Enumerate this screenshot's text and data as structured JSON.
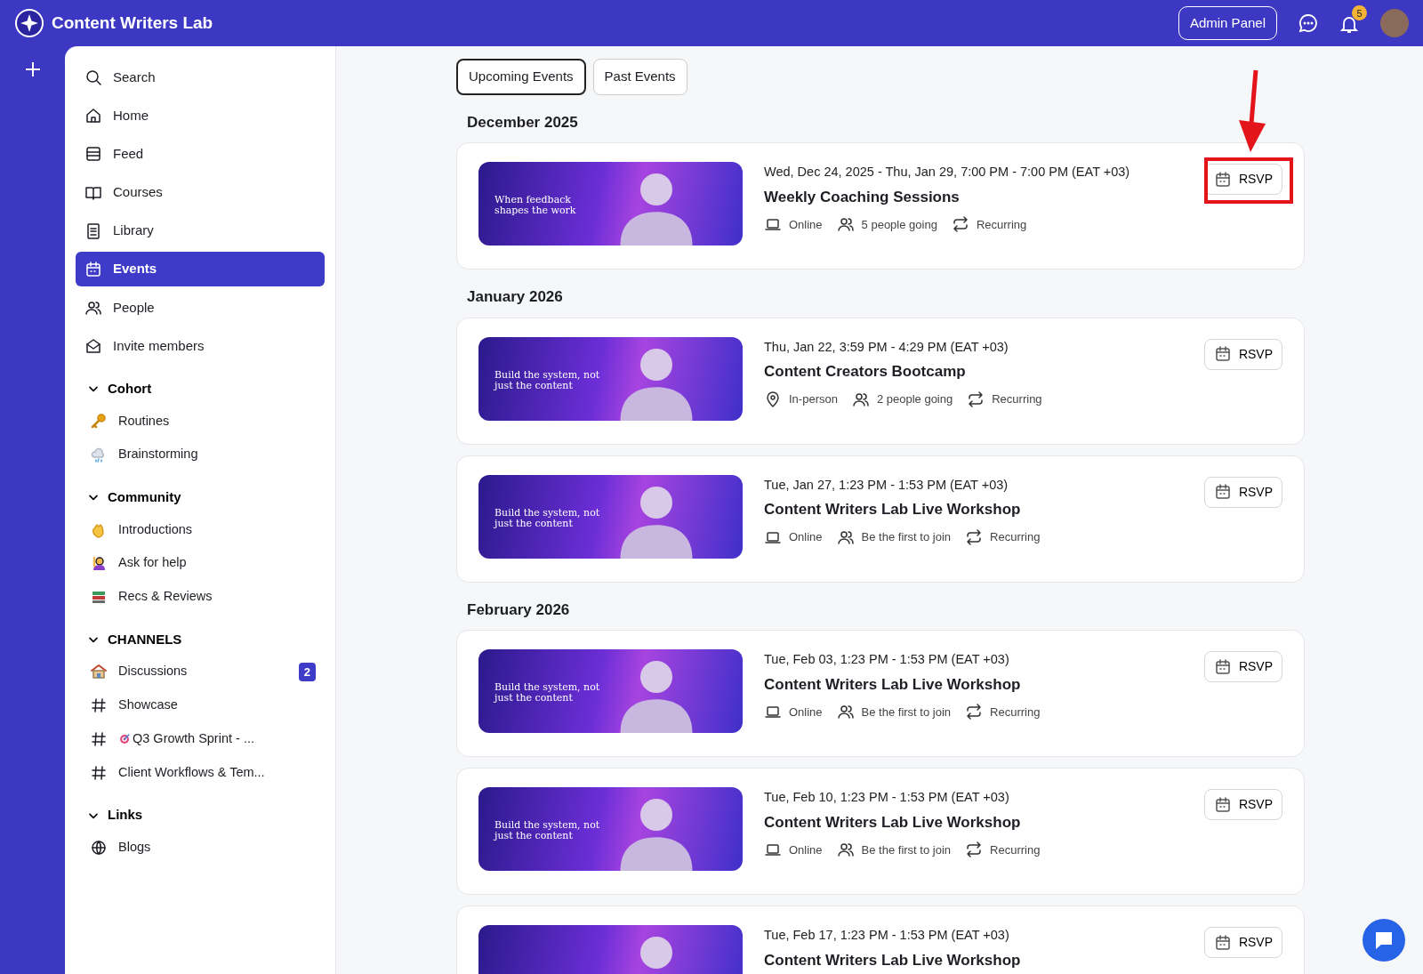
{
  "app": {
    "title": "Content Writers Lab"
  },
  "header": {
    "admin_button": "Admin Panel",
    "notification_count": "5"
  },
  "sidebar": {
    "nav": [
      {
        "label": "Search",
        "kind": "search",
        "selected": false
      },
      {
        "label": "Home",
        "kind": "home",
        "selected": false
      },
      {
        "label": "Feed",
        "kind": "feed",
        "selected": false
      },
      {
        "label": "Courses",
        "kind": "book",
        "selected": false
      },
      {
        "label": "Library",
        "kind": "library",
        "selected": false
      },
      {
        "label": "Events",
        "kind": "calendar",
        "selected": true
      },
      {
        "label": "People",
        "kind": "people",
        "selected": false
      },
      {
        "label": "Invite members",
        "kind": "mail",
        "selected": false
      }
    ],
    "sections": [
      {
        "title": "Cohort",
        "expanded": true,
        "items": [
          {
            "label": "Routines",
            "kind": "key"
          },
          {
            "label": "Brainstorming",
            "kind": "cloud"
          }
        ]
      },
      {
        "title": "Community",
        "expanded": true,
        "items": [
          {
            "label": "Introductions",
            "kind": "wave"
          },
          {
            "label": "Ask for help",
            "kind": "hand"
          },
          {
            "label": "Recs & Reviews",
            "kind": "books"
          }
        ]
      },
      {
        "title": "CHANNELS",
        "expanded": true,
        "items": [
          {
            "label": "Discussions",
            "kind": "house",
            "badge": "2"
          },
          {
            "label": "Showcase",
            "kind": "hash"
          },
          {
            "label": "Q3 Growth Sprint - ...",
            "kind": "hash-target"
          },
          {
            "label": "Client Workflows & Tem...",
            "kind": "hash"
          }
        ]
      },
      {
        "title": "Links",
        "expanded": true,
        "items": [
          {
            "label": "Blogs",
            "kind": "globe"
          }
        ]
      }
    ]
  },
  "tabs": [
    {
      "label": "Upcoming Events",
      "selected": true
    },
    {
      "label": "Past Events",
      "selected": false
    }
  ],
  "months": [
    {
      "title": "December 2025",
      "events": [
        {
          "date": "Wed, Dec 24, 2025 - Thu, Jan 29, 7:00 PM - 7:00 PM (EAT +03)",
          "title": "Weekly Coaching Sessions",
          "banner": {
            "headline": "When feedback shapes the work"
          },
          "kind": "online",
          "location": "Online",
          "attendance": "5 people going",
          "recurrence": "Recurring",
          "rsvp": "RSVP",
          "annotated": true
        }
      ]
    },
    {
      "title": "January 2026",
      "events": [
        {
          "date": "Thu, Jan 22, 3:59 PM - 4:29 PM (EAT +03)",
          "title": "Content Creators Bootcamp",
          "banner": {
            "headline": "Build the system, not just the content"
          },
          "kind": "in-person",
          "location": "In-person",
          "attendance": "2 people going",
          "recurrence": "Recurring",
          "rsvp": "RSVP",
          "annotated": false
        },
        {
          "date": "Tue, Jan 27, 1:23 PM - 1:53 PM (EAT +03)",
          "title": "Content Writers Lab Live Workshop",
          "banner": {
            "headline": "Build the system, not just the content"
          },
          "kind": "online",
          "location": "Online",
          "attendance": "Be the first to join",
          "recurrence": "Recurring",
          "rsvp": "RSVP",
          "annotated": false
        }
      ]
    },
    {
      "title": "February 2026",
      "events": [
        {
          "date": "Tue, Feb 03, 1:23 PM - 1:53 PM (EAT +03)",
          "title": "Content Writers Lab Live Workshop",
          "banner": {
            "headline": "Build the system, not just the content"
          },
          "kind": "online",
          "location": "Online",
          "attendance": "Be the first to join",
          "recurrence": "Recurring",
          "rsvp": "RSVP",
          "annotated": false
        },
        {
          "date": "Tue, Feb 10, 1:23 PM - 1:53 PM (EAT +03)",
          "title": "Content Writers Lab Live Workshop",
          "banner": {
            "headline": "Build the system, not just the content"
          },
          "kind": "online",
          "location": "Online",
          "attendance": "Be the first to join",
          "recurrence": "Recurring",
          "rsvp": "RSVP",
          "annotated": false
        },
        {
          "date": "Tue, Feb 17, 1:23 PM - 1:53 PM (EAT +03)",
          "title": "Content Writers Lab Live Workshop",
          "rsvp": "RSVP",
          "annotated": false
        }
      ]
    }
  ]
}
